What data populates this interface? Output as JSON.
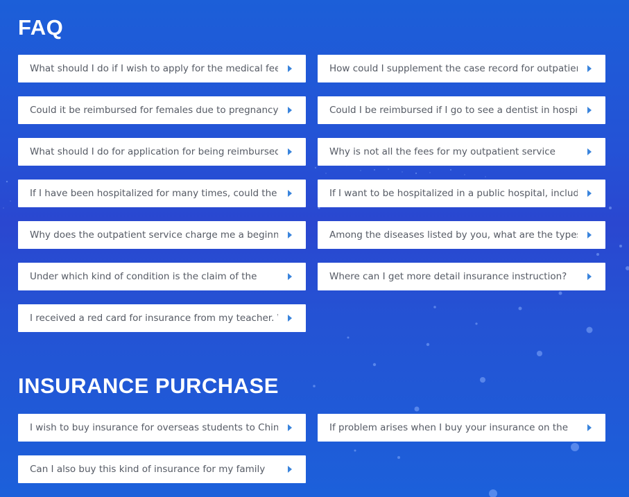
{
  "faq": {
    "title": "FAQ",
    "items": [
      "What should I do if I wish to apply for the medical fees to",
      "How could I supplement the case record for outpatient",
      "Could it be reimbursed for females due to pregnancy,",
      "Could I be reimbursed if I go to see a dentist in hospital?",
      "What should I do for application for being reimbursed",
      "Why is not all the fees for my outpatient service",
      "If I have been hospitalized for many times, could the fees",
      "If I want to be hospitalized in a public hospital, including",
      "Why does the outpatient service charge me a beginning",
      "Among the diseases listed by you, what are the types for",
      "Under which kind of condition is the claim of the",
      "Where can I get more detail insurance instruction?",
      "I received a red card for insurance from my teacher. What"
    ]
  },
  "insurance": {
    "title": "INSURANCE PURCHASE",
    "items": [
      "I wish to buy insurance for overseas students to China, so",
      "If problem arises when I buy your insurance on the",
      "Can I also buy this kind of insurance for my family"
    ]
  },
  "icons": {
    "item_arrow": "caret-right-icon"
  },
  "colors": {
    "background": "#1f58d6",
    "card": "#ffffff",
    "text": "#555a64",
    "arrow": "#3a84dc"
  }
}
